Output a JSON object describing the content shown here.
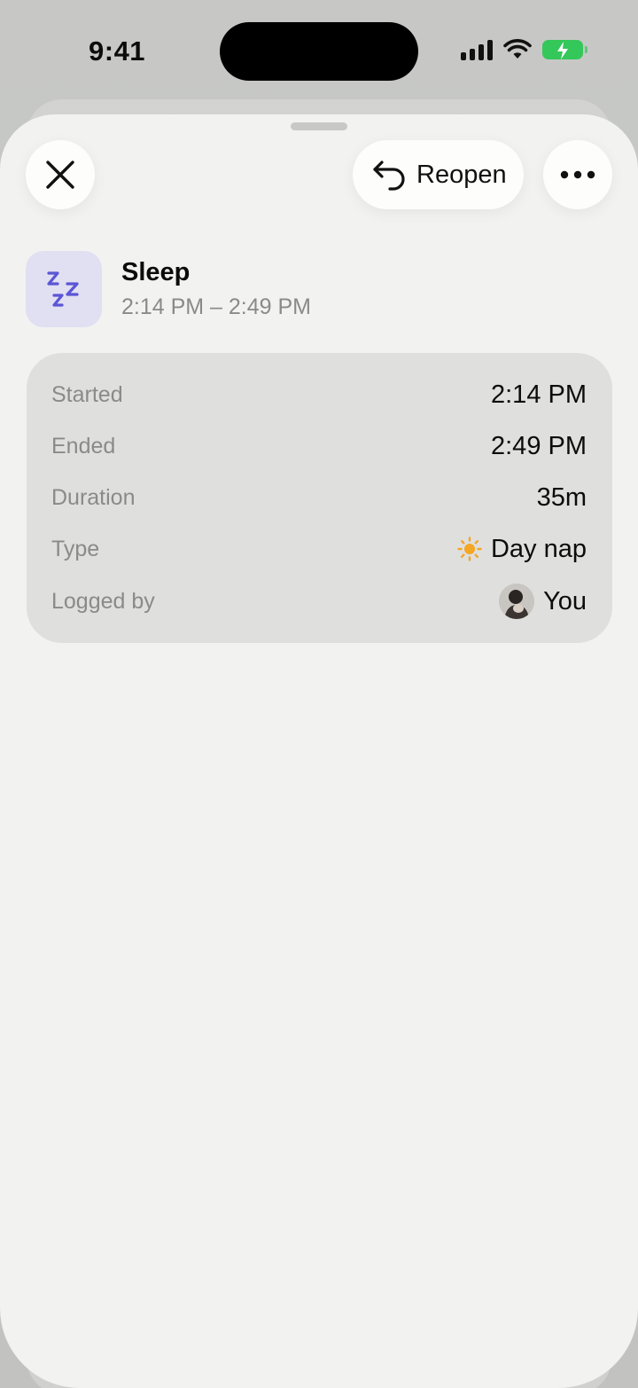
{
  "status_bar": {
    "time": "9:41",
    "icons": [
      "cellular-signal-icon",
      "wifi-icon",
      "battery-charging-icon"
    ],
    "battery_color": "#34c759"
  },
  "toolbar": {
    "close_icon": "close-icon",
    "reopen_label": "Reopen",
    "reopen_icon": "undo-arrow-icon",
    "more_icon": "ellipsis-icon"
  },
  "entry": {
    "icon": "sleep-zzz-icon",
    "icon_color": "#5b55d6",
    "icon_bg": "#e1dff2",
    "title": "Sleep",
    "time_range": "2:14 PM – 2:49 PM"
  },
  "details": {
    "started_label": "Started",
    "started_value": "2:14 PM",
    "ended_label": "Ended",
    "ended_value": "2:49 PM",
    "duration_label": "Duration",
    "duration_value": "35m",
    "type_label": "Type",
    "type_value": "Day nap",
    "type_icon": "sun-icon",
    "type_icon_color": "#f5a623",
    "logged_by_label": "Logged by",
    "logged_by_value": "You",
    "logged_by_icon": "avatar"
  }
}
